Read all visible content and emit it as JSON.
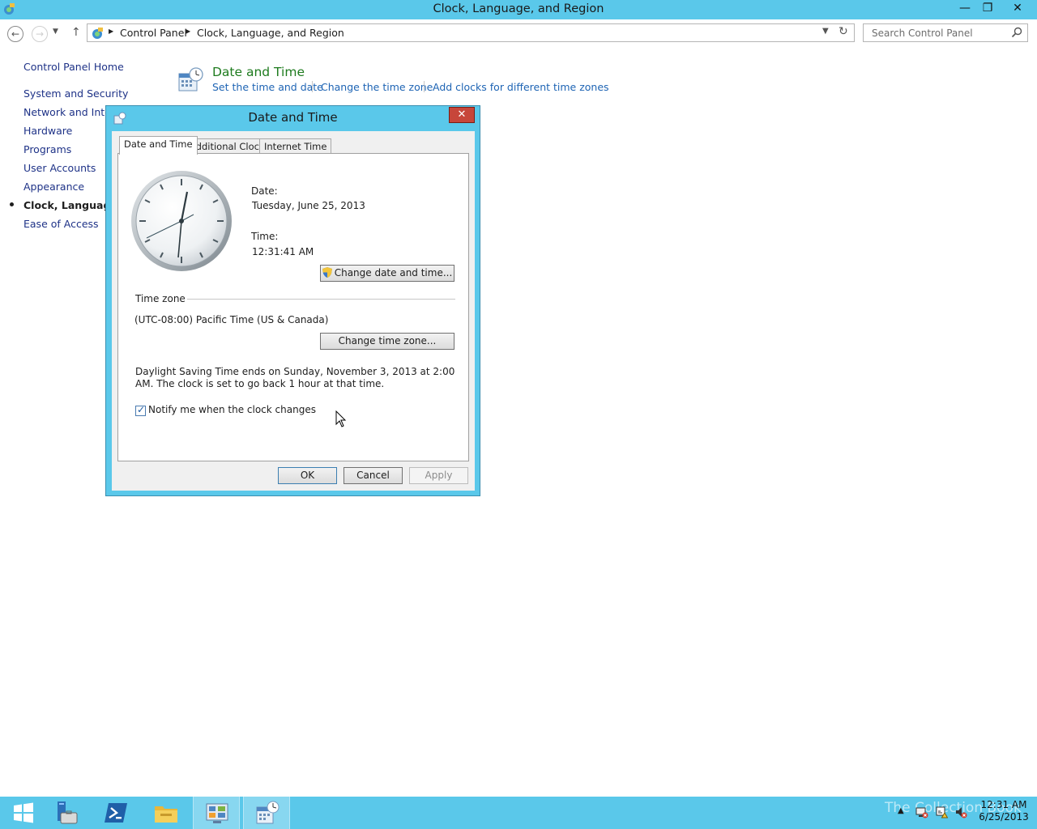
{
  "window": {
    "title": "Clock, Language, and Region",
    "minimize": "—",
    "maximize": "❐",
    "close": "✕"
  },
  "addressbar": {
    "crumbs": [
      "Control Panel",
      "Clock, Language, and Region"
    ],
    "search_placeholder": "Search Control Panel"
  },
  "leftnav": {
    "home": "Control Panel Home",
    "items": [
      "System and Security",
      "Network and Internet",
      "Hardware",
      "Programs",
      "User Accounts",
      "Appearance",
      "Clock, Language, and Region",
      "Ease of Access"
    ]
  },
  "category": {
    "title": "Date and Time",
    "links": [
      "Set the time and date",
      "Change the time zone",
      "Add clocks for different time zones"
    ]
  },
  "dialog": {
    "title": "Date and Time",
    "tabs": [
      "Date and Time",
      "Additional Clocks",
      "Internet Time"
    ],
    "active_tab": "Date and Time",
    "date_label": "Date:",
    "date_value": "Tuesday, June 25, 2013",
    "time_label": "Time:",
    "time_value": "12:31:41 AM",
    "change_dt_button": "Change date and time...",
    "timezone_group": "Time zone",
    "timezone_value": "(UTC-08:00) Pacific Time (US & Canada)",
    "change_tz_button": "Change time zone...",
    "dst_text": "Daylight Saving Time ends on Sunday, November 3, 2013 at 2:00 AM. The clock is set to go back 1 hour at that time.",
    "notify_label": "Notify me when the clock changes",
    "notify_checked": true,
    "ok": "OK",
    "cancel": "Cancel",
    "apply": "Apply"
  },
  "taskbar": {
    "watermark": "The Collection Book",
    "clock_time": "12:31 AM",
    "clock_date": "6/25/2013",
    "apps": [
      "start-icon",
      "server-manager-icon",
      "powershell-icon",
      "file-explorer-icon",
      "control-panel-icon",
      "date-time-icon"
    ]
  },
  "colors": {
    "accent": "#5ac8ea",
    "link": "#1e64b4",
    "category_title": "#1e7b1e",
    "close_red": "#c7463a"
  }
}
